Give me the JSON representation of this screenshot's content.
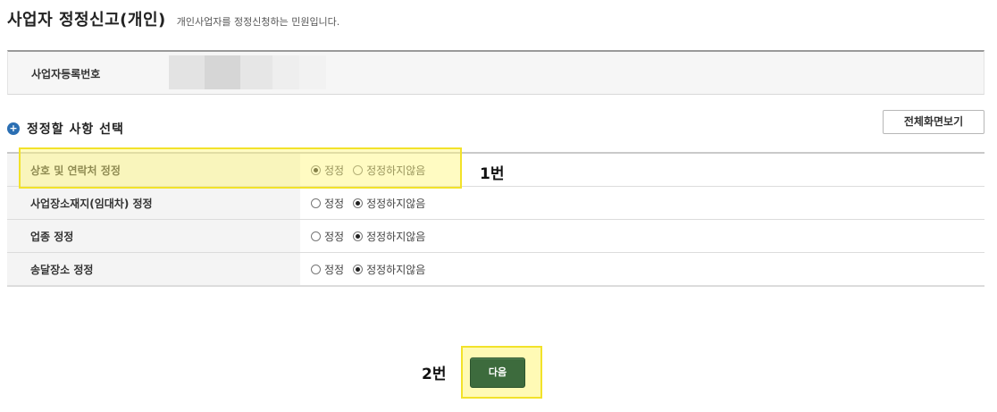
{
  "header": {
    "title": "사업자 정정신고(개인)",
    "description": "개인사업자를 정정신청하는 민원입니다."
  },
  "registration": {
    "label": "사업자등록번호",
    "blur_colors": [
      "#e3e3e3",
      "#ececec",
      "#d8d8d8",
      "#e6e6e6",
      "#f0f0f0"
    ]
  },
  "section": {
    "bullet_icon": "plus-circle-icon",
    "title": "정정할 사항 선택",
    "fullscreen_label": "전체화면보기"
  },
  "options": [
    {
      "label": "상호 및 연락처 정정",
      "choice_yes": "정정",
      "choice_no": "정정하지않음",
      "selected": "yes"
    },
    {
      "label": "사업장소재지(임대차) 정정",
      "choice_yes": "정정",
      "choice_no": "정정하지않음",
      "selected": "no"
    },
    {
      "label": "업종 정정",
      "choice_yes": "정정",
      "choice_no": "정정하지않음",
      "selected": "no"
    },
    {
      "label": "송달장소 정정",
      "choice_yes": "정정",
      "choice_no": "정정하지않음",
      "selected": "no"
    }
  ],
  "annotations": {
    "step1": "1번",
    "step2": "2번",
    "highlight_color": "#f2e22a"
  },
  "footer": {
    "next_label": "다음",
    "next_color": "#3d6b3d"
  }
}
